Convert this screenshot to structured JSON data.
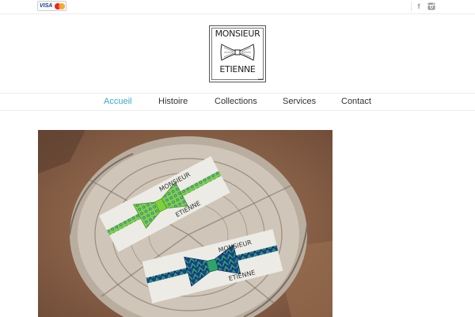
{
  "topbar": {
    "payment": {
      "visa_label": "VISA",
      "icon": "mastercard-icon"
    },
    "social": [
      {
        "name": "facebook-icon",
        "glyph": "f"
      },
      {
        "name": "instagram-icon"
      }
    ]
  },
  "logo": {
    "top_word": "MONSIEUR",
    "bottom_word": "ETIENNE",
    "icon": "bow-tie-icon"
  },
  "nav": {
    "active_color": "#39a8cf",
    "items": [
      {
        "label": "Accueil",
        "active": true
      },
      {
        "label": "Histoire",
        "active": false
      },
      {
        "label": "Collections",
        "active": false
      },
      {
        "label": "Services",
        "active": false
      },
      {
        "label": "Contact",
        "active": false
      }
    ]
  },
  "photo": {
    "card_texts": [
      "MONSIEUR",
      "ETIENNE"
    ],
    "bow_colors": [
      "#7fd13b",
      "#1f6fb5",
      "#2ea36c"
    ]
  }
}
